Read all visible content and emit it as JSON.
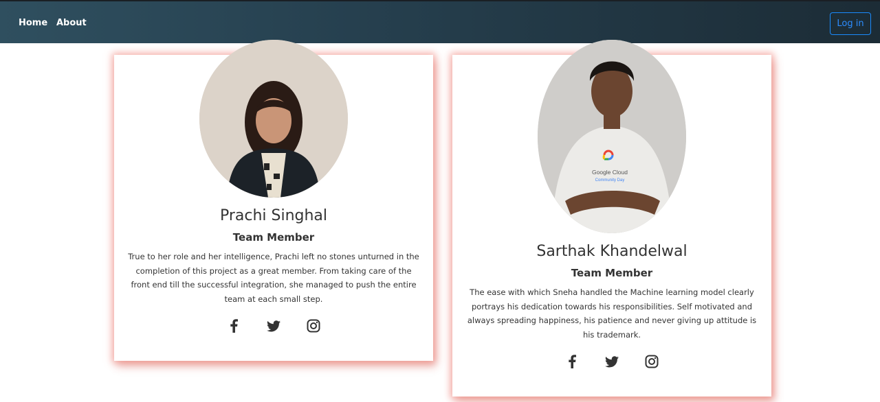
{
  "nav": {
    "home_label": "Home",
    "about_label": "About",
    "login_label": "Log in"
  },
  "colors": {
    "navbar_left": "#2f4f5f",
    "navbar_right": "#1c2c36",
    "login_accent": "#1a8cff",
    "card_shadow": "#f0786e",
    "icon": "#333333"
  },
  "members": [
    {
      "name": "Prachi Singhal",
      "role": "Team Member",
      "bio": "True to her role and her intelligence, Prachi left no stones unturned in the completion of this project as a great member. From taking care of the front end till the successful integration, she managed to push the entire team at each small step.",
      "socials": [
        "facebook-icon",
        "twitter-icon",
        "instagram-icon"
      ]
    },
    {
      "name": "Sarthak Khandelwal",
      "role": "Team Member",
      "bio": "The ease with which Sneha handled the Machine learning model clearly portrays his dedication towards his responsibilities. Self motivated and always spreading happiness, his patience and never giving up attitude is his trademark.",
      "shirt_text": "Google Cloud",
      "shirt_subtext": "Community Day",
      "socials": [
        "facebook-icon",
        "twitter-icon",
        "instagram-icon"
      ]
    }
  ]
}
